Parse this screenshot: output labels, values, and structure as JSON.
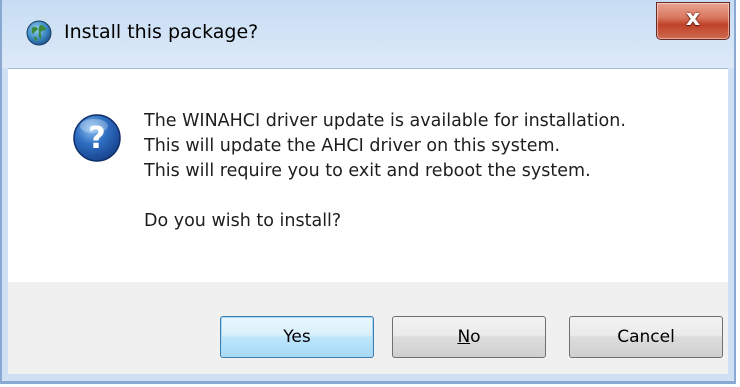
{
  "window": {
    "title": "Install this package?",
    "close_glyph": "x",
    "app_icon": "globe-icon"
  },
  "message": {
    "icon": "question-icon",
    "lines": [
      "The WINAHCI driver update is available for installation.",
      "This will update the AHCI driver on this system.",
      "This will require you to exit and reboot the system."
    ],
    "prompt": "Do you wish to install?"
  },
  "buttons": {
    "yes": "Yes",
    "no_mnemonic": "N",
    "no_rest": "o",
    "cancel": "Cancel"
  },
  "colors": {
    "titlebar": "#c7dcf3",
    "close": "#c0432a",
    "default_button": "#bee6fd"
  }
}
